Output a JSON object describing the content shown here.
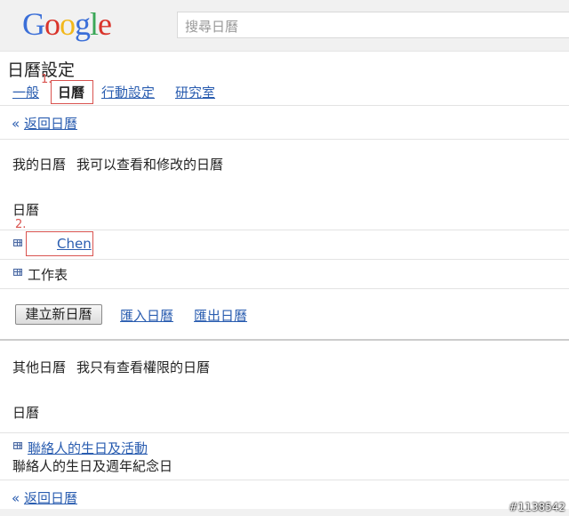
{
  "header": {
    "logo": "Google",
    "search_placeholder": "搜尋日曆"
  },
  "page": {
    "title": "日曆設定"
  },
  "tabs": [
    {
      "label": "一般",
      "active": false
    },
    {
      "label": "日曆",
      "active": true
    },
    {
      "label": "行動設定",
      "active": false
    },
    {
      "label": "研究室",
      "active": false
    }
  ],
  "steps": {
    "one": "1.",
    "two": "2."
  },
  "back_link": {
    "arrow": "«",
    "label": "返回日曆"
  },
  "my_calendars": {
    "heading": "我的日曆",
    "description": "我可以查看和修改的日曆",
    "column_header": "日曆",
    "items": [
      {
        "name": "Chen"
      },
      {
        "name": "工作表"
      }
    ]
  },
  "actions": {
    "create_button": "建立新日曆",
    "import_link": "匯入日曆",
    "export_link": "匯出日曆"
  },
  "other_calendars": {
    "heading": "其他日曆",
    "description": "我只有查看權限的日曆",
    "column_header": "日曆",
    "items": [
      {
        "name": "聯絡人的生日及活動",
        "description": "聯絡人的生日及週年紀念日"
      }
    ]
  },
  "watermark": "#1138542",
  "colors": {
    "link": "#2a5db0",
    "highlight_box": "#d9534f"
  }
}
